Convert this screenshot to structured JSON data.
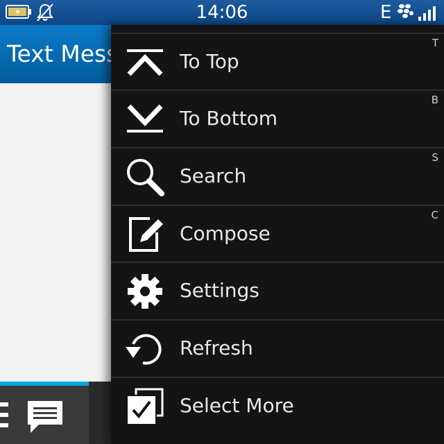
{
  "status_bar": {
    "time": "14:06",
    "network": "E",
    "icons": [
      "battery-charging-icon",
      "notifications-muted-icon",
      "blackberry-messenger-icon",
      "signal-strength-icon"
    ]
  },
  "app": {
    "title": "Text Messages"
  },
  "menu": {
    "items": [
      {
        "label": "To Top",
        "shortcut": "T",
        "icon": "to-top-icon"
      },
      {
        "label": "To Bottom",
        "shortcut": "B",
        "icon": "to-bottom-icon"
      },
      {
        "label": "Search",
        "shortcut": "S",
        "icon": "search-icon"
      },
      {
        "label": "Compose",
        "shortcut": "C",
        "icon": "compose-icon"
      },
      {
        "label": "Settings",
        "shortcut": "",
        "icon": "gear-icon"
      },
      {
        "label": "Refresh",
        "shortcut": "",
        "icon": "refresh-icon"
      },
      {
        "label": "Select More",
        "shortcut": "",
        "icon": "select-more-icon"
      }
    ]
  },
  "colors": {
    "status_bar": "#0f4685",
    "title_bar": "#0b7bc9",
    "accent": "#00a8df",
    "menu_background": "#141414"
  }
}
